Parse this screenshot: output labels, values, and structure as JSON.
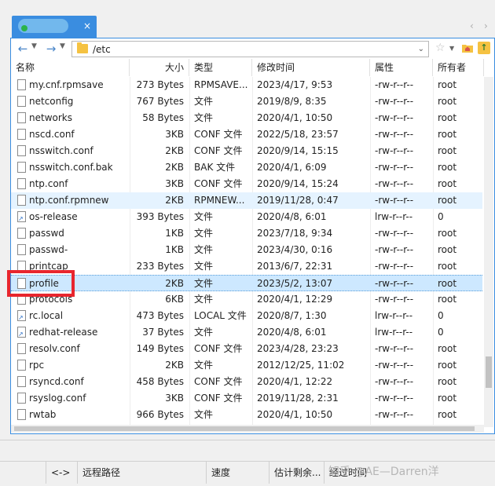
{
  "tab": {
    "close_glyph": "×"
  },
  "tab_nav": {
    "left": "‹",
    "right": "›"
  },
  "toolbar": {
    "back": "←",
    "forward": "→",
    "path": "/etc",
    "path_dropdown": "⌄",
    "bookmark_icon": "☆"
  },
  "columns": [
    "名称",
    "大小",
    "类型",
    "修改时间",
    "属性",
    "所有者"
  ],
  "files": [
    {
      "name": "my.cnf.rpmsave",
      "size": "273 Bytes",
      "type": "RPMSAVE...",
      "modified": "2023/4/17, 9:53",
      "attr": "-rw-r--r--",
      "owner": "root",
      "icon": "file-icon"
    },
    {
      "name": "netconfig",
      "size": "767 Bytes",
      "type": "文件",
      "modified": "2019/8/9, 8:35",
      "attr": "-rw-r--r--",
      "owner": "root",
      "icon": "file-icon"
    },
    {
      "name": "networks",
      "size": "58 Bytes",
      "type": "文件",
      "modified": "2020/4/1, 10:50",
      "attr": "-rw-r--r--",
      "owner": "root",
      "icon": "file-icon"
    },
    {
      "name": "nscd.conf",
      "size": "3KB",
      "type": "CONF 文件",
      "modified": "2022/5/18, 23:57",
      "attr": "-rw-r--r--",
      "owner": "root",
      "icon": "file-icon"
    },
    {
      "name": "nsswitch.conf",
      "size": "2KB",
      "type": "CONF 文件",
      "modified": "2020/9/14, 15:15",
      "attr": "-rw-r--r--",
      "owner": "root",
      "icon": "file-icon"
    },
    {
      "name": "nsswitch.conf.bak",
      "size": "2KB",
      "type": "BAK 文件",
      "modified": "2020/4/1, 6:09",
      "attr": "-rw-r--r--",
      "owner": "root",
      "icon": "file-icon"
    },
    {
      "name": "ntp.conf",
      "size": "3KB",
      "type": "CONF 文件",
      "modified": "2020/9/14, 15:24",
      "attr": "-rw-r--r--",
      "owner": "root",
      "icon": "file-icon"
    },
    {
      "name": "ntp.conf.rpmnew",
      "size": "2KB",
      "type": "RPMNEW...",
      "modified": "2019/11/28, 0:47",
      "attr": "-rw-r--r--",
      "owner": "root",
      "icon": "file-icon",
      "state": "hover"
    },
    {
      "name": "os-release",
      "size": "393 Bytes",
      "type": "文件",
      "modified": "2020/4/8, 6:01",
      "attr": "lrw-r--r--",
      "owner": "0",
      "icon": "link-file-icon"
    },
    {
      "name": "passwd",
      "size": "1KB",
      "type": "文件",
      "modified": "2023/7/18, 9:34",
      "attr": "-rw-r--r--",
      "owner": "root",
      "icon": "file-icon"
    },
    {
      "name": "passwd-",
      "size": "1KB",
      "type": "文件",
      "modified": "2023/4/30, 0:16",
      "attr": "-rw-r--r--",
      "owner": "root",
      "icon": "file-icon"
    },
    {
      "name": "printcap",
      "size": "233 Bytes",
      "type": "文件",
      "modified": "2013/6/7, 22:31",
      "attr": "-rw-r--r--",
      "owner": "root",
      "icon": "file-icon"
    },
    {
      "name": "profile",
      "size": "2KB",
      "type": "文件",
      "modified": "2023/5/2, 13:07",
      "attr": "-rw-r--r--",
      "owner": "root",
      "icon": "file-icon",
      "state": "selected"
    },
    {
      "name": "protocols",
      "size": "6KB",
      "type": "文件",
      "modified": "2020/4/1, 12:29",
      "attr": "-rw-r--r--",
      "owner": "root",
      "icon": "file-icon"
    },
    {
      "name": "rc.local",
      "size": "473 Bytes",
      "type": "LOCAL 文件",
      "modified": "2020/8/7, 1:30",
      "attr": "lrw-r--r--",
      "owner": "0",
      "icon": "link-file-icon"
    },
    {
      "name": "redhat-release",
      "size": "37 Bytes",
      "type": "文件",
      "modified": "2020/4/8, 6:01",
      "attr": "lrw-r--r--",
      "owner": "0",
      "icon": "link-file-icon"
    },
    {
      "name": "resolv.conf",
      "size": "149 Bytes",
      "type": "CONF 文件",
      "modified": "2023/4/28, 23:23",
      "attr": "-rw-r--r--",
      "owner": "root",
      "icon": "file-icon"
    },
    {
      "name": "rpc",
      "size": "2KB",
      "type": "文件",
      "modified": "2012/12/25, 11:02",
      "attr": "-rw-r--r--",
      "owner": "root",
      "icon": "file-icon"
    },
    {
      "name": "rsyncd.conf",
      "size": "458 Bytes",
      "type": "CONF 文件",
      "modified": "2020/4/1, 12:22",
      "attr": "-rw-r--r--",
      "owner": "root",
      "icon": "file-icon"
    },
    {
      "name": "rsyslog.conf",
      "size": "3KB",
      "type": "CONF 文件",
      "modified": "2019/11/28, 2:31",
      "attr": "-rw-r--r--",
      "owner": "root",
      "icon": "file-icon"
    },
    {
      "name": "rwtab",
      "size": "966 Bytes",
      "type": "文件",
      "modified": "2020/4/1, 10:50",
      "attr": "-rw-r--r--",
      "owner": "root",
      "icon": "file-icon"
    }
  ],
  "status": {
    "direction": "<->",
    "remote_path": "远程路径",
    "speed": "速度",
    "eta": "估计剩余...",
    "elapsed": "经过时间"
  },
  "watermark": "知乎 @AE—Darren洋",
  "colors": {
    "accent": "#3a8de0",
    "selection": "#cde8ff",
    "highlight_box": "#e8262e",
    "folder": "#f5c242"
  }
}
